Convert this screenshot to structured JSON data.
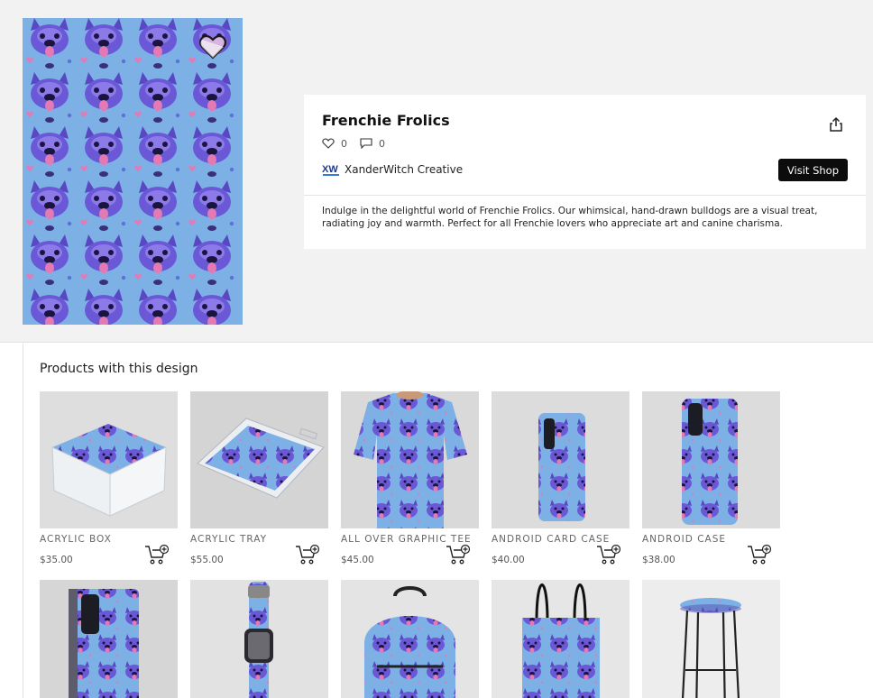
{
  "design": {
    "title": "Frenchie Frolics",
    "likes": "0",
    "comments": "0",
    "artist_name": "XanderWitch Creative",
    "artist_logo_text": "XW",
    "visit_shop_label": "Visit Shop",
    "description": "Indulge in the delightful world of Frenchie Frolics. Our whimsical, hand-drawn bulldogs are a visual treat, radiating joy and warmth. Perfect for all Frenchie lovers who appreciate art and canine charisma."
  },
  "products_section": {
    "title": "Products with this design"
  },
  "products": [
    {
      "name": "ACRYLIC BOX",
      "price": "$35.00",
      "image": "acrylic-box"
    },
    {
      "name": "ACRYLIC TRAY",
      "price": "$55.00",
      "image": "acrylic-tray"
    },
    {
      "name": "ALL OVER GRAPHIC TEE",
      "price": "$45.00",
      "image": "tee"
    },
    {
      "name": "ANDROID CARD CASE",
      "price": "$40.00",
      "image": "card-case"
    },
    {
      "name": "ANDROID CASE",
      "price": "$38.00",
      "image": "android-case"
    },
    {
      "name": "",
      "price": "",
      "image": "wallet-case"
    },
    {
      "name": "",
      "price": "",
      "image": "watch-band"
    },
    {
      "name": "",
      "price": "",
      "image": "backpack"
    },
    {
      "name": "",
      "price": "",
      "image": "tote-bag"
    },
    {
      "name": "",
      "price": "",
      "image": "bar-stool"
    }
  ],
  "colors": {
    "pattern_bg": "#7db1e6",
    "dog": "#6a58d6",
    "dog_dark": "#2a2060",
    "tongue": "#e37ab4",
    "button_bg": "#0c0c0c"
  },
  "icons": {
    "like": "heart-handshake-icon",
    "comment": "speech-bubble-icon",
    "share": "share-icon",
    "cart": "add-to-cart-icon",
    "favorite": "heart-icon"
  }
}
